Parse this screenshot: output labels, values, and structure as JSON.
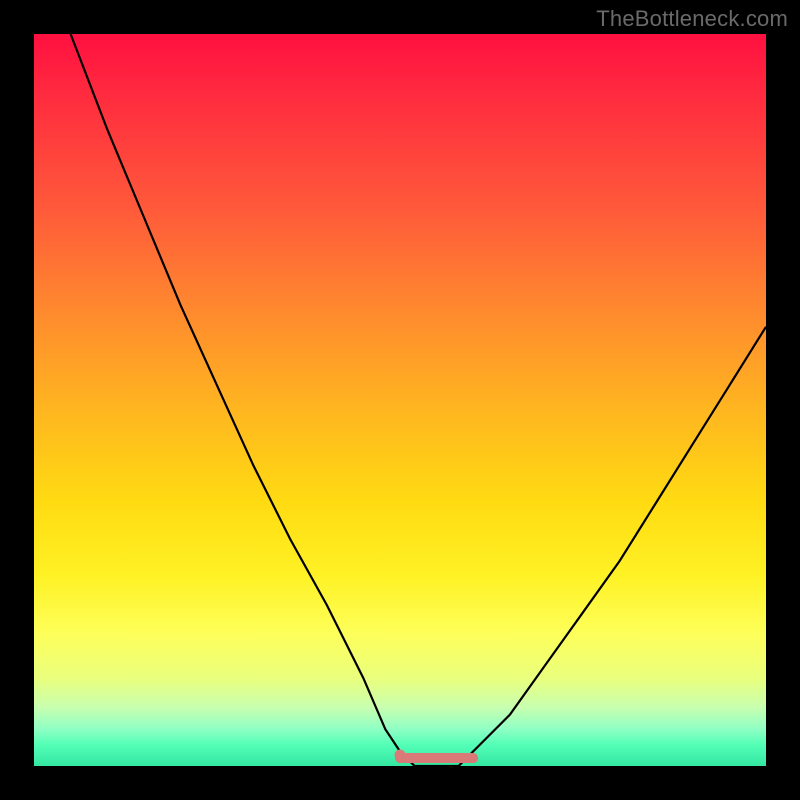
{
  "watermark": "TheBottleneck.com",
  "colors": {
    "frame": "#000000",
    "curve_stroke": "#000000",
    "minimum_mark": "#d97a78",
    "gradient_top": "#ff1040",
    "gradient_bottom": "#33e7a2"
  },
  "chart_data": {
    "type": "line",
    "title": "",
    "xlabel": "",
    "ylabel": "",
    "xlim": [
      0,
      100
    ],
    "ylim": [
      0,
      100
    ],
    "grid": false,
    "series": [
      {
        "name": "bottleneck-curve",
        "x": [
          5,
          10,
          15,
          20,
          25,
          30,
          35,
          40,
          45,
          48,
          50,
          52,
          55,
          58,
          60,
          65,
          70,
          75,
          80,
          85,
          90,
          95,
          100
        ],
        "values": [
          100,
          87,
          75,
          63,
          52,
          41,
          31,
          22,
          12,
          5,
          2,
          0,
          0,
          0,
          2,
          7,
          14,
          21,
          28,
          36,
          44,
          52,
          60
        ]
      }
    ],
    "annotations": [
      {
        "name": "optimal-range-marker",
        "x_range": [
          50,
          60
        ],
        "y": 0,
        "style": "thick-pink-underline"
      },
      {
        "name": "optimal-start-dot",
        "x": 50,
        "y": 1.5
      }
    ]
  }
}
